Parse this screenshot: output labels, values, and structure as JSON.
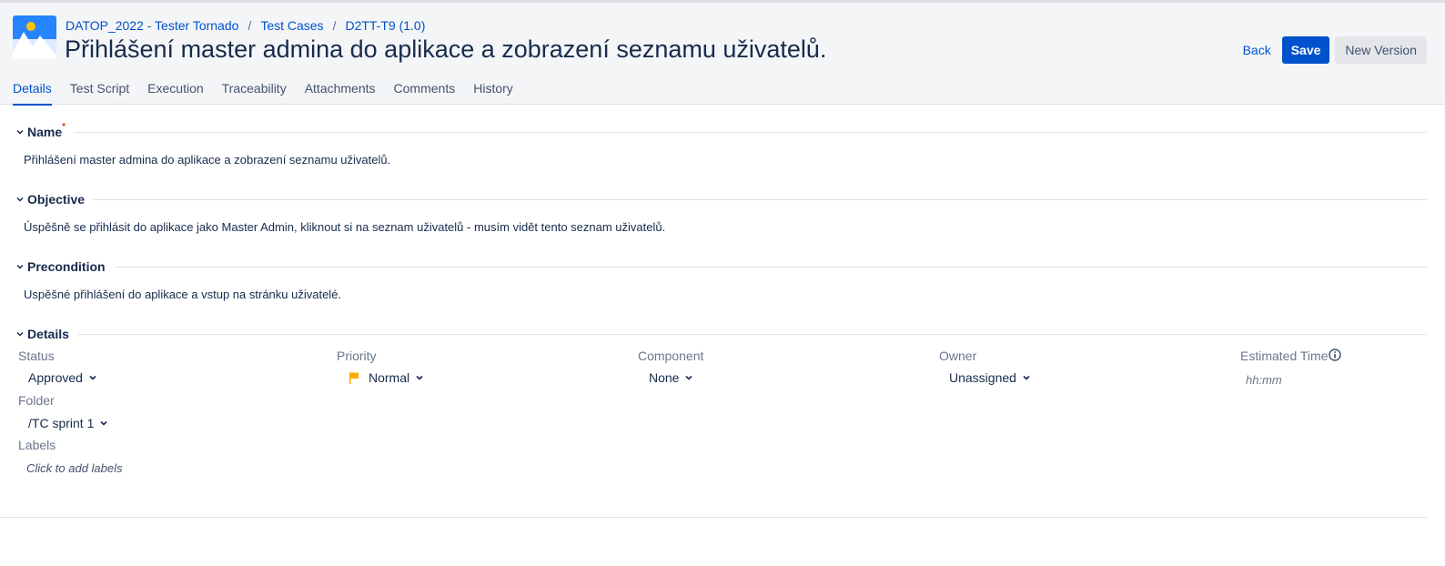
{
  "breadcrumb": {
    "project": "DATOP_2022 - Tester Tornado",
    "section": "Test Cases",
    "key": "D2TT-T9 (1.0)"
  },
  "page": {
    "title": "Přihlášení master admina do aplikace a zobrazení seznamu uživatelů."
  },
  "actions": {
    "back": "Back",
    "save": "Save",
    "new_version": "New Version"
  },
  "tabs": [
    "Details",
    "Test Script",
    "Execution",
    "Traceability",
    "Attachments",
    "Comments",
    "History"
  ],
  "active_tab": "Details",
  "sections": {
    "name": {
      "title": "Name",
      "required_mark": "*",
      "text": "Přihlášení master admina do aplikace a zobrazení seznamu uživatelů."
    },
    "objective": {
      "title": "Objective",
      "text": "Úspěšně se přihlásit do aplikace jako Master Admin, kliknout si na seznam uživatelů - musím vidět tento seznam uživatelů."
    },
    "precondition": {
      "title": "Precondition",
      "text": "Uspěšné přihlášení do aplikace a vstup na stránku  uživatelé."
    },
    "details": {
      "title": "Details"
    }
  },
  "fields": {
    "status": {
      "label": "Status",
      "value": "Approved"
    },
    "priority": {
      "label": "Priority",
      "value": "Normal",
      "icon": "flag-icon",
      "icon_color": "#ffab00"
    },
    "component": {
      "label": "Component",
      "value": "None"
    },
    "owner": {
      "label": "Owner",
      "value": "Unassigned"
    },
    "estimated_time": {
      "label": "Estimated Time",
      "placeholder": "hh:mm"
    },
    "folder": {
      "label": "Folder",
      "value": "/TC sprint 1"
    },
    "labels": {
      "label": "Labels",
      "placeholder": "Click to add labels"
    }
  },
  "colors": {
    "accent": "#0052cc",
    "header_bg": "#f4f5f7",
    "required": "#de350b"
  }
}
